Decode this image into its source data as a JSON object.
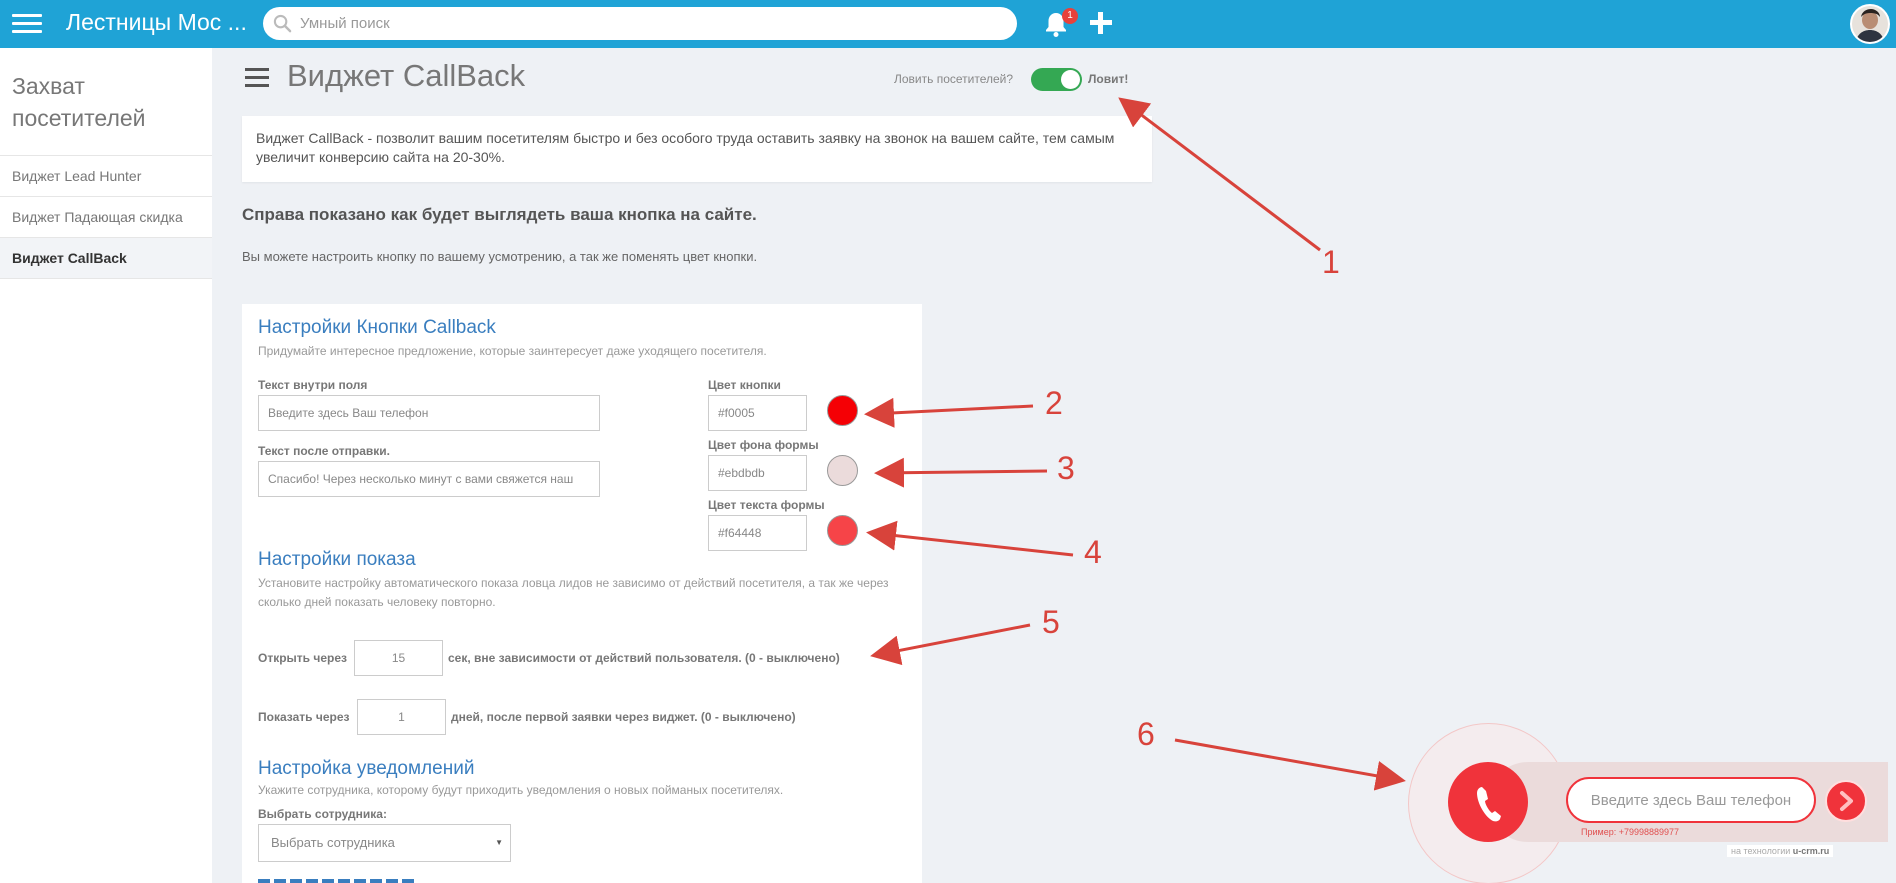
{
  "header": {
    "app_title": "Лестницы Мос ...",
    "search_placeholder": "Умный поиск",
    "notification_count": "1"
  },
  "sidebar": {
    "title": "Захват посетителей",
    "items": [
      {
        "label": "Виджет Lead Hunter"
      },
      {
        "label": "Виджет Падающая скидка"
      },
      {
        "label": "Виджет CallBack"
      }
    ],
    "active_index": 2
  },
  "page": {
    "title": "Виджет CallBack",
    "catch_label": "Ловить посетителей?",
    "catch_status": "Ловит!",
    "catch_enabled": true,
    "info": "Виджет CallBack - позволит вашим посетителям быстро и без особого труда оставить заявку на звонок на вашем сайте, тем самым увеличит конверсию сайта на 20-30%.",
    "subhead": "Справа показано как будет выглядеть ваша кнопка на сайте.",
    "subtext": "Вы можете настроить кнопку по вашему усмотрению, а так же поменять цвет кнопки."
  },
  "button_settings": {
    "title": "Настройки Кнопки Callback",
    "desc": "Придумайте интересное предложение, которые заинтересует даже уходящего посетителя.",
    "field_text_label": "Текст внутри поля",
    "field_text_value": "Введите здесь Ваш телефон",
    "after_send_label": "Текст после отправки.",
    "after_send_value": "Спасибо! Через несколько минут с вами свяжется наш",
    "button_color_label": "Цвет кнопки",
    "button_color_value": "#f0005",
    "form_bg_label": "Цвет фона формы",
    "form_bg_value": "#ebdbdb",
    "form_text_label": "Цвет текста формы",
    "form_text_value": "#f64448",
    "swatch_colors": {
      "button": "#f50005",
      "form_bg": "#ebdbdb",
      "form_text": "#f64448"
    }
  },
  "display_settings": {
    "title": "Настройки показа",
    "desc": "Установите настройку автоматического показа ловца лидов не зависимо от действий посетителя, а так же через сколько дней показать человеку повторно.",
    "open_label": "Открыть через",
    "open_value": "15",
    "open_suffix": "сек, вне зависимости от действий пользователя. (0 - выключено)",
    "show_label": "Показать через",
    "show_value": "1",
    "show_suffix": "дней, после первой заявки через виджет. (0 - выключено)"
  },
  "notify_settings": {
    "title": "Настройка уведомлений",
    "desc": "Укажите сотрудника, которому будут приходить уведомления о новых пойманых посетителях.",
    "employee_label": "Выбрать сотрудника:",
    "employee_selected": "Выбрать сотрудника"
  },
  "annotations": [
    "1",
    "2",
    "3",
    "4",
    "5",
    "6"
  ],
  "widget_preview": {
    "input_placeholder": "Введите здесь Ваш телефон",
    "example": "Пример: +79998889977",
    "powered_prefix": "на технологии",
    "powered_brand": "u-crm.ru"
  },
  "colors": {
    "accent": "#1fa3d6",
    "toggle_on": "#34a853",
    "section_title": "#3a7ebf",
    "annotation": "#d8433b",
    "widget_red": "#f0333b"
  }
}
